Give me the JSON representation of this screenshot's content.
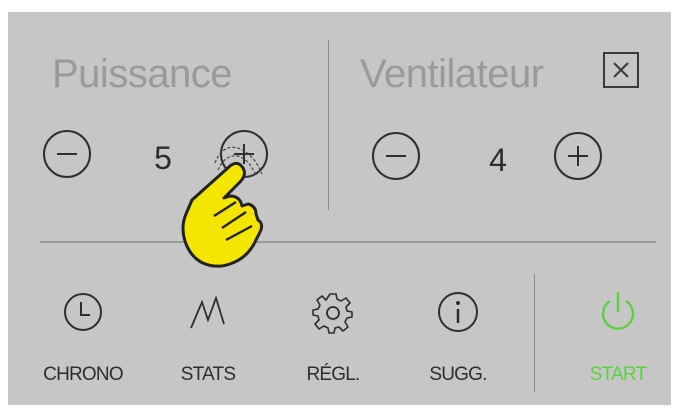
{
  "power": {
    "title": "Puissance",
    "value": "5"
  },
  "fan": {
    "title": "Ventilateur",
    "value": "4"
  },
  "close_icon": "close-icon",
  "nav": {
    "items": [
      {
        "label": "CHRONO",
        "icon": "clock-icon"
      },
      {
        "label": "STATS",
        "icon": "stats-icon"
      },
      {
        "label": "RÉGL.",
        "icon": "gear-icon"
      },
      {
        "label": "SUGG.",
        "icon": "info-icon"
      }
    ],
    "start": {
      "label": "START",
      "icon": "power-icon"
    }
  },
  "colors": {
    "background": "#c6c6c6",
    "accent": "#5ad23c",
    "text": "#2e2e2e",
    "muted": "#9a9a9a",
    "hand": "#f4e600"
  }
}
